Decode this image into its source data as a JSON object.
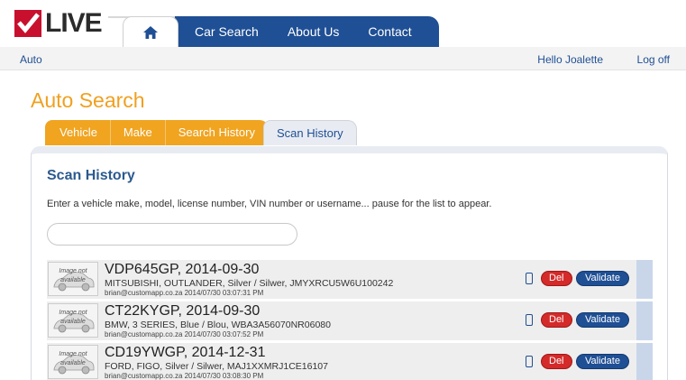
{
  "brand": {
    "logo_text": "LIVE"
  },
  "nav": {
    "home_icon": "home-icon",
    "tabs": [
      {
        "label": "Car Search"
      },
      {
        "label": "About Us"
      },
      {
        "label": "Contact"
      }
    ]
  },
  "subbar": {
    "crumb": "Auto",
    "greeting": "Hello Joalette",
    "logout": "Log off"
  },
  "page_title": "Auto Search",
  "tabs": [
    {
      "label": "Vehicle"
    },
    {
      "label": "Make"
    },
    {
      "label": "Search History"
    },
    {
      "label": "Scan History"
    }
  ],
  "panel": {
    "title": "Scan History",
    "description": "Enter a vehicle make, model, license number, VIN number or username... pause for the list to appear.",
    "search_value": ""
  },
  "thumb_text": {
    "line1": "Image not",
    "line2": "available"
  },
  "actions": {
    "del_label": "Del",
    "validate_label": "Validate"
  },
  "results": [
    {
      "title": "VDP645GP, 2014-09-30",
      "subtitle": "MITSUBISHI, OUTLANDER, Silver / Silwer, JMYXRCU5W6U100242",
      "meta": "brian@customapp.co.za 2014/07/30 03:07:31 PM"
    },
    {
      "title": "CT22KYGP, 2014-09-30",
      "subtitle": "BMW, 3 SERIES, Blue / Blou, WBA3A56070NR06080",
      "meta": "brian@customapp.co.za 2014/07/30 03:07:52 PM"
    },
    {
      "title": "CD19YWGP, 2014-12-31",
      "subtitle": "FORD, FIGO, Silver / Silwer, MAJ1XXMRJ1CE16107",
      "meta": "brian@customapp.co.za 2014/07/30 03:08:30 PM"
    }
  ],
  "colors": {
    "brand_red": "#c8102e",
    "nav_blue": "#1f4f94",
    "accent_orange": "#f0a420",
    "del_red": "#d42a2a"
  }
}
